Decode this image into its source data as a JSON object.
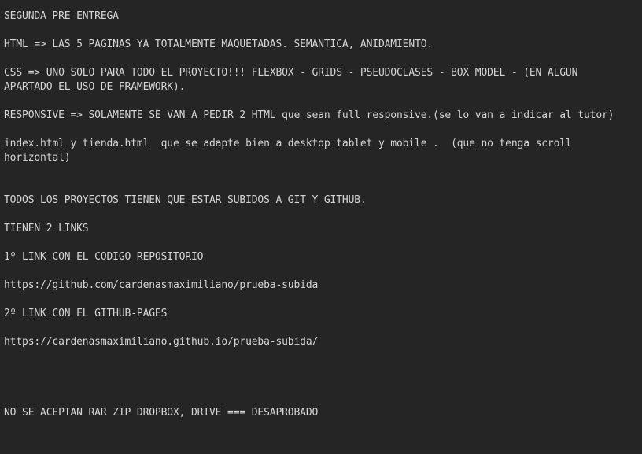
{
  "note": {
    "lines": [
      "SEGUNDA PRE ENTREGA",
      "",
      "HTML => LAS 5 PAGINAS YA TOTALMENTE MAQUETADAS. SEMANTICA, ANIDAMIENTO.",
      "",
      "CSS => UNO SOLO PARA TODO EL PROYECTO!!! FLEXBOX - GRIDS - PSEUDOCLASES - BOX MODEL - (EN ALGUN",
      "APARTADO EL USO DE FRAMEWORK).",
      "",
      "RESPONSIVE => SOLAMENTE SE VAN A PEDIR 2 HTML que sean full responsive.(se lo van a indicar al tutor)",
      "",
      "index.html y tienda.html  que se adapte bien a desktop tablet y mobile .  (que no tenga scroll",
      "horizontal)",
      "",
      "",
      "TODOS LOS PROYECTOS TIENEN QUE ESTAR SUBIDOS A GIT Y GITHUB.",
      "",
      "TIENEN 2 LINKS",
      "",
      "1º LINK CON EL CODIGO REPOSITORIO",
      "",
      "https://github.com/cardenasmaximiliano/prueba-subida",
      "",
      "2º LINK CON EL GITHUB-PAGES",
      "",
      "https://cardenasmaximiliano.github.io/prueba-subida/",
      "",
      "",
      "",
      "",
      "NO SE ACEPTAN RAR ZIP DROPBOX, DRIVE === DESAPROBADO"
    ]
  }
}
